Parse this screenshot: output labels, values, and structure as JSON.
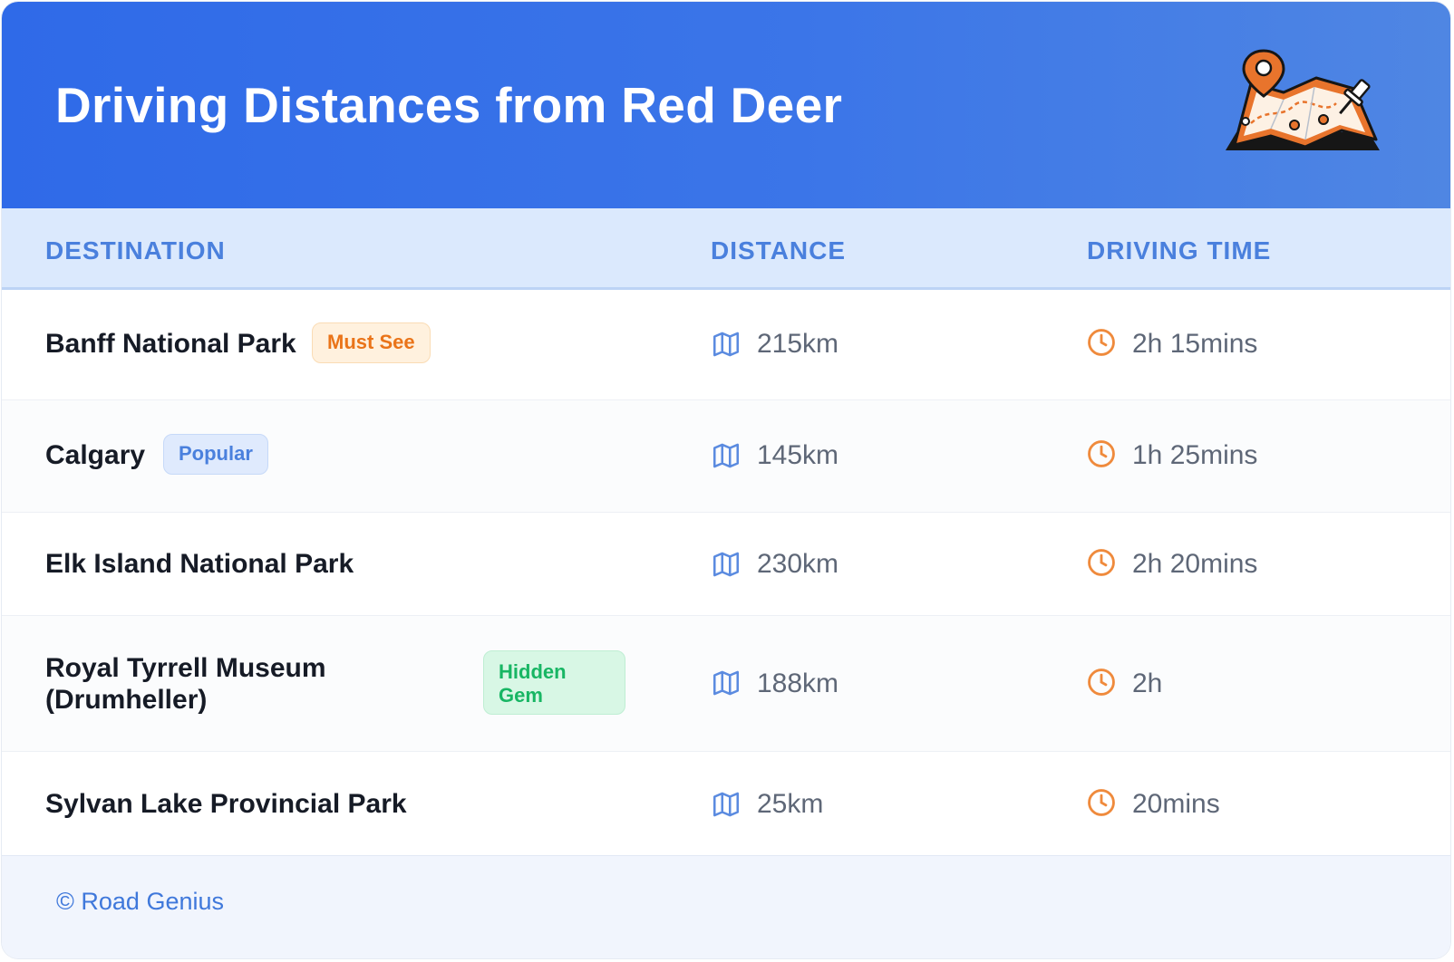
{
  "header": {
    "title": "Driving Distances from Red Deer",
    "illustration_icon": "folded-map-with-pins-icon"
  },
  "columns": {
    "destination": "DESTINATION",
    "distance": "DISTANCE",
    "driving_time": "DRIVING TIME"
  },
  "icons": {
    "distance": "map-icon",
    "time": "clock-icon"
  },
  "rows": [
    {
      "destination": "Banff National Park",
      "badge": "Must See",
      "badge_color": "#ea7419",
      "distance": "215km",
      "time": "2h 15mins"
    },
    {
      "destination": "Calgary",
      "badge": "Popular",
      "badge_color": "#4a80dd",
      "distance": "145km",
      "time": "1h 25mins"
    },
    {
      "destination": "Elk Island National Park",
      "badge": "",
      "distance": "230km",
      "time": "2h 20mins"
    },
    {
      "destination": "Royal Tyrrell Museum (Drumheller)",
      "badge": "Hidden Gem",
      "badge_color": "#18b664",
      "distance": "188km",
      "time": "2h"
    },
    {
      "destination": "Sylvan Lake Provincial Park",
      "badge": "",
      "distance": "25km",
      "time": "20mins"
    }
  ],
  "footer": {
    "text": "© Road Genius"
  },
  "colors": {
    "header_gradient_start": "#2f6ae8",
    "header_gradient_end": "#4f86e3",
    "accent_blue": "#4a80dd",
    "clock_orange": "#ef8a3c"
  }
}
